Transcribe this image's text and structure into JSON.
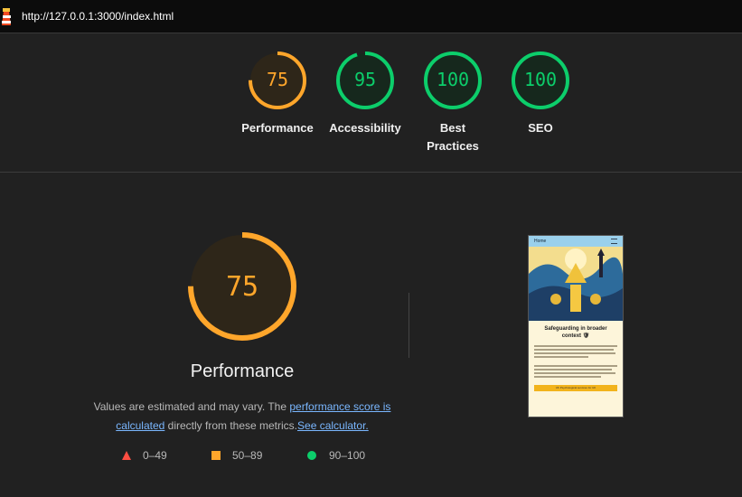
{
  "browser": {
    "url": "http://127.0.0.1:3000/index.html"
  },
  "gauges": [
    {
      "score": "75",
      "label": "Performance",
      "color": "#ffa62b",
      "fraction": 0.75
    },
    {
      "score": "95",
      "label": "Accessibility",
      "color": "#0cce6b",
      "fraction": 0.95
    },
    {
      "score": "100",
      "label": "Best Practices",
      "color": "#0cce6b",
      "fraction": 1.0
    },
    {
      "score": "100",
      "label": "SEO",
      "color": "#0cce6b",
      "fraction": 1.0
    }
  ],
  "main": {
    "score": "75",
    "fraction": 0.75,
    "title": "Performance",
    "desc_prefix": "Values are estimated and may vary. The ",
    "link_score": "performance score is calculated",
    "desc_middle": " directly from these metrics.",
    "link_calc": "See calculator.",
    "colors": {
      "fail": "#ff4e42",
      "average": "#ffa62b",
      "pass": "#0cce6b"
    }
  },
  "legend": [
    {
      "range": "0–49",
      "shape": "triangle-icon"
    },
    {
      "range": "50–89",
      "shape": "square-icon"
    },
    {
      "range": "90–100",
      "shape": "circle-icon"
    }
  ],
  "screenshot": {
    "nav": "Home",
    "heading": "Safeguarding in broader context 🛡",
    "button": "UK Psychological services for UK"
  }
}
